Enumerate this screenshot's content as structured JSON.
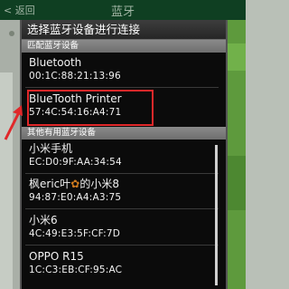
{
  "appbar": {
    "back_label": "< 返回",
    "title": "蓝牙"
  },
  "dialog": {
    "title": "选择蓝牙设备进行连接"
  },
  "paired": {
    "header": "匹配蓝牙设备",
    "devices": [
      {
        "name": "Bluetooth",
        "address": "00:1C:88:21:13:96"
      },
      {
        "name": "BlueTooth Printer",
        "address": "57:4C:54:16:A4:71"
      }
    ]
  },
  "others": {
    "header": "其他有用蓝牙设备",
    "devices": [
      {
        "name": "小米手机",
        "address": "EC:D0:9F:AA:34:54"
      },
      {
        "name_prefix": "枫eric叶",
        "name_suffix": "的小米8",
        "address": "94:87:E0:A4:A3:75"
      },
      {
        "name": "小米6",
        "address": "4C:49:E3:5F:CF:7D"
      },
      {
        "name": "OPPO R15",
        "address": "1C:C3:EB:CF:95:AC"
      }
    ]
  },
  "colors": {
    "highlight": "#e0282a",
    "arrow": "#e0282a",
    "accent_green": "#5e9a3d"
  },
  "icons": {
    "maple_leaf": "maple-leaf-icon"
  }
}
